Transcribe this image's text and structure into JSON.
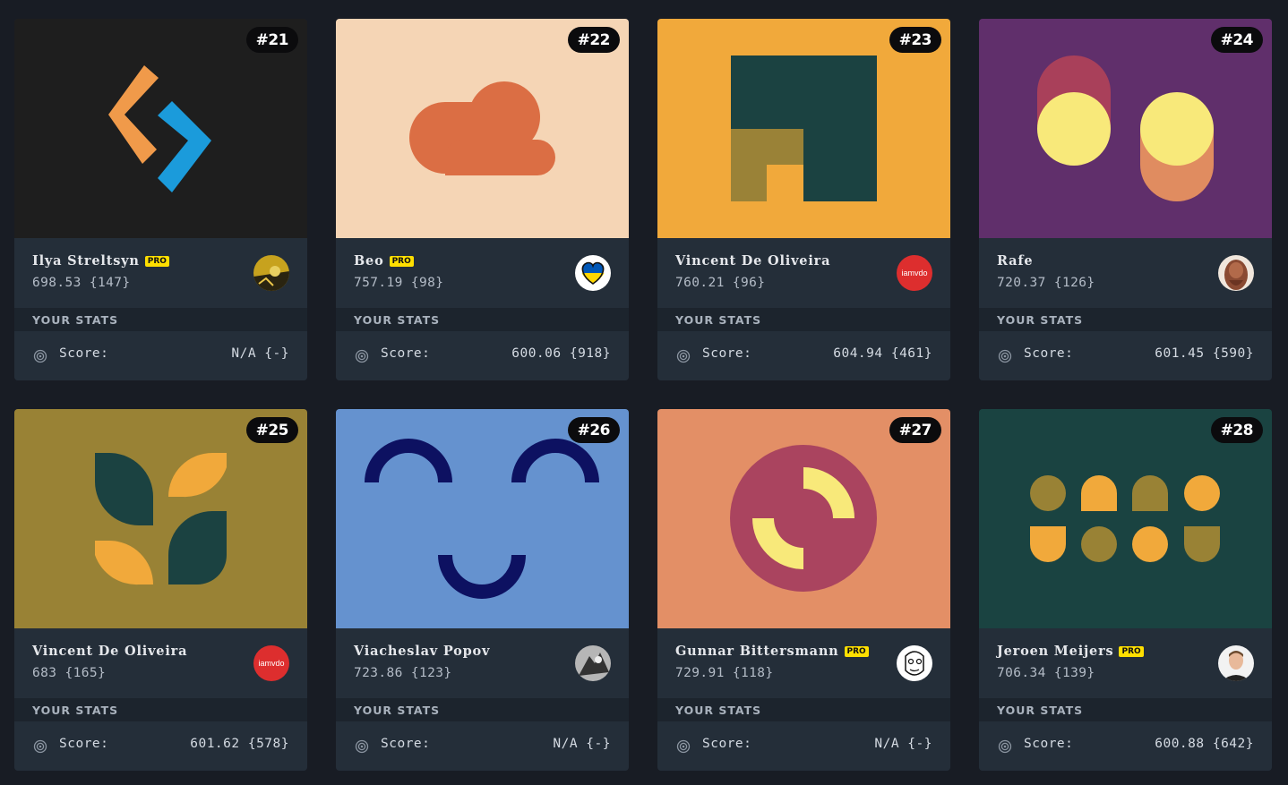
{
  "stats_heading": "YOUR STATS",
  "score_label": "Score:",
  "pro_badge": "PRO",
  "cards": [
    {
      "rank": "#21",
      "author": "Ilya Streltsyn",
      "pro": true,
      "avg": "698.53 {147}",
      "your_score": "N/A {-}",
      "art_bg": "#1e1e1e",
      "avatar": "yellow-photo"
    },
    {
      "rank": "#22",
      "author": "Beo",
      "pro": true,
      "avg": "757.19 {98}",
      "your_score": "600.06 {918}",
      "art_bg": "#f5d5b5",
      "avatar": "ukraine-heart"
    },
    {
      "rank": "#23",
      "author": "Vincent De Oliveira",
      "pro": false,
      "avg": "760.21 {96}",
      "your_score": "604.94 {461}",
      "art_bg": "#f1a93b",
      "avatar": "iamvdo",
      "avatar_text": "iamvdo"
    },
    {
      "rank": "#24",
      "author": "Rafe",
      "pro": false,
      "avg": "720.37 {126}",
      "your_score": "601.45 {590}",
      "art_bg": "#602f6b",
      "avatar": "bearded-portrait"
    },
    {
      "rank": "#25",
      "author": "Vincent De Oliveira",
      "pro": false,
      "avg": "683 {165}",
      "your_score": "601.62 {578}",
      "art_bg": "#998235",
      "avatar": "iamvdo",
      "avatar_text": "iamvdo"
    },
    {
      "rank": "#26",
      "author": "Viacheslav Popov",
      "pro": false,
      "avg": "723.86 {123}",
      "your_score": "N/A {-}",
      "art_bg": "#6592cf",
      "avatar": "grey-photo"
    },
    {
      "rank": "#27",
      "author": "Gunnar Bittersmann",
      "pro": true,
      "avg": "729.91 {118}",
      "your_score": "N/A {-}",
      "art_bg": "#e38f66",
      "avatar": "sketch-face"
    },
    {
      "rank": "#28",
      "author": "Jeroen Meijers",
      "pro": true,
      "avg": "706.34 {139}",
      "your_score": "600.88 {642}",
      "art_bg": "#1a4341",
      "avatar": "man-photo"
    }
  ]
}
